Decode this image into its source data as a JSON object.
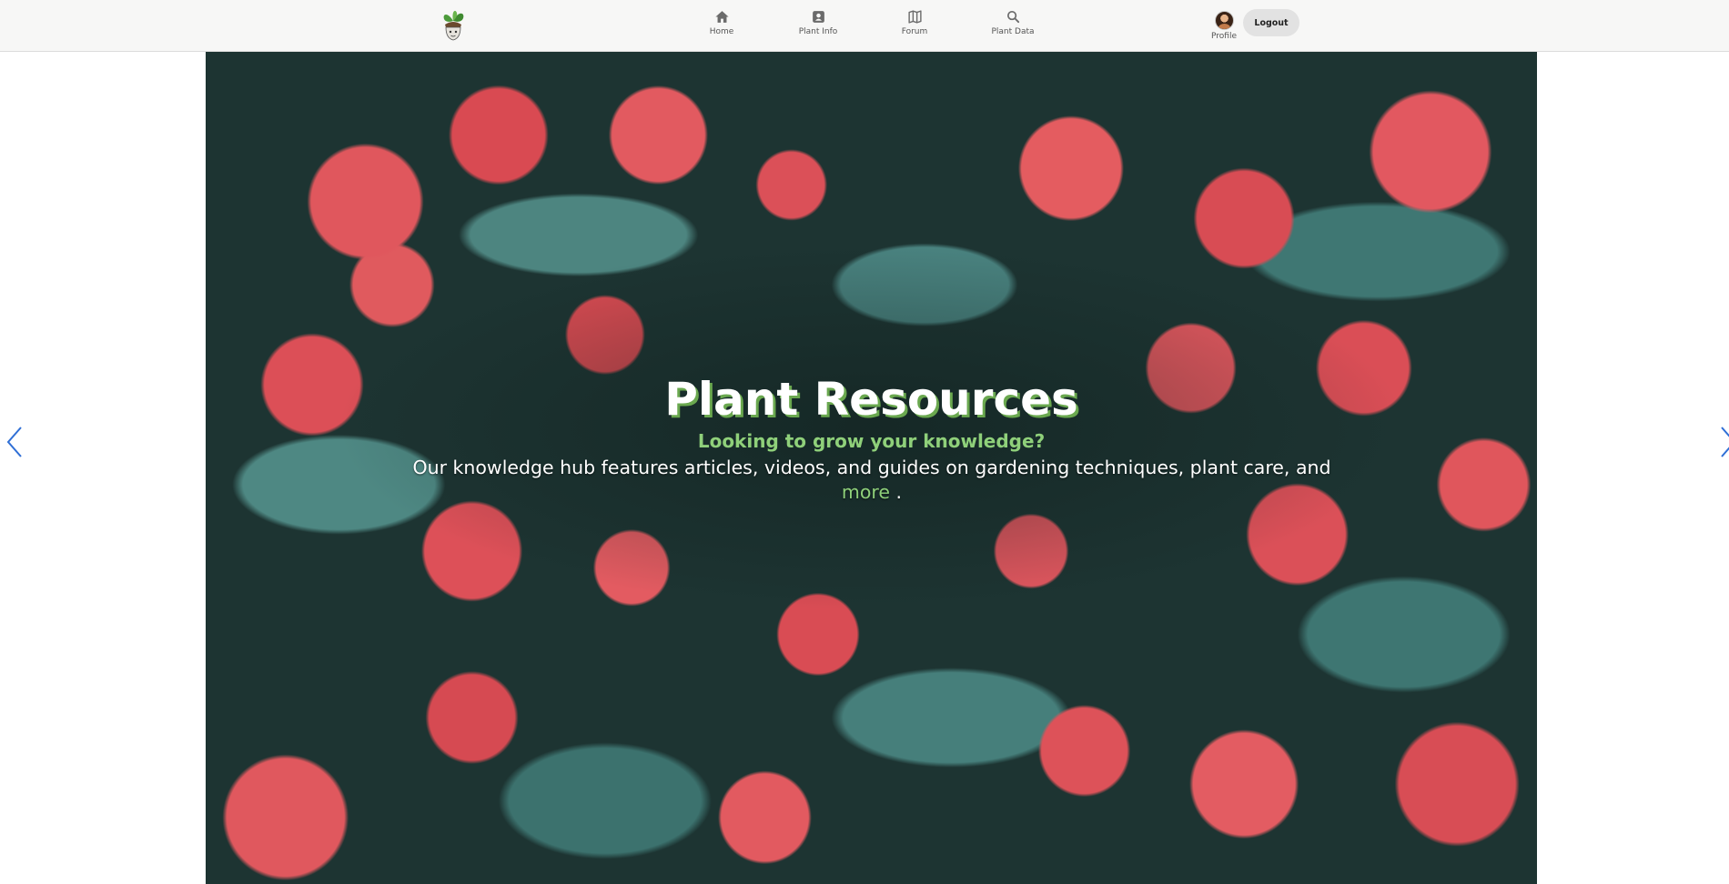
{
  "nav": {
    "items": [
      {
        "label": "Home",
        "icon": "home-icon"
      },
      {
        "label": "Plant Info",
        "icon": "plant-info-icon"
      },
      {
        "label": "Forum",
        "icon": "map-icon"
      },
      {
        "label": "Plant Data",
        "icon": "search-icon"
      }
    ],
    "profile_label": "Profile",
    "logout_label": "Logout"
  },
  "hero": {
    "title": "Plant Resources",
    "subtitle": "Looking to grow your knowledge?",
    "description_part1": "Our knowledge hub features articles, videos, and guides on gardening techniques, plant care, and",
    "more_link": "more",
    "description_end": "."
  },
  "colors": {
    "accent_green": "#8fd07a",
    "nav_bg": "#f7f7f6",
    "arrow_blue": "#2f6fd6"
  }
}
